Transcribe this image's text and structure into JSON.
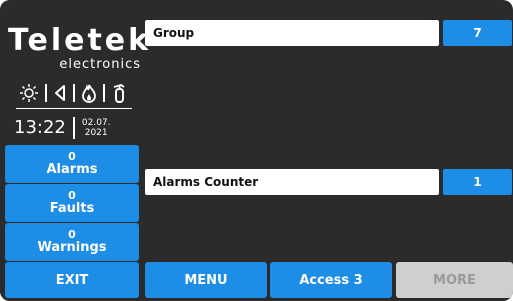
{
  "brand": {
    "name": "Teletek",
    "tagline": "electronics"
  },
  "status_icons": [
    "sun-icon",
    "speaker-icon",
    "fire-icon",
    "fire-extinguisher-icon"
  ],
  "clock": {
    "time": "13:22",
    "date_line1": "02.07.",
    "date_line2": "2021"
  },
  "sidebar": {
    "alarms": {
      "count": "0",
      "label": "Alarms"
    },
    "faults": {
      "count": "0",
      "label": "Faults"
    },
    "warnings": {
      "count": "0",
      "label": "Warnings"
    }
  },
  "main": {
    "group": {
      "label": "Group",
      "value": "7"
    },
    "alarms_counter": {
      "label": "Alarms Counter",
      "value": "1"
    }
  },
  "bottom_bar": {
    "exit": "EXIT",
    "menu": "MENU",
    "access": "Access 3",
    "more": "MORE"
  },
  "colors": {
    "accent": "#1e8de6",
    "background": "#2b2b2b",
    "disabled": "#cfcfcf"
  }
}
